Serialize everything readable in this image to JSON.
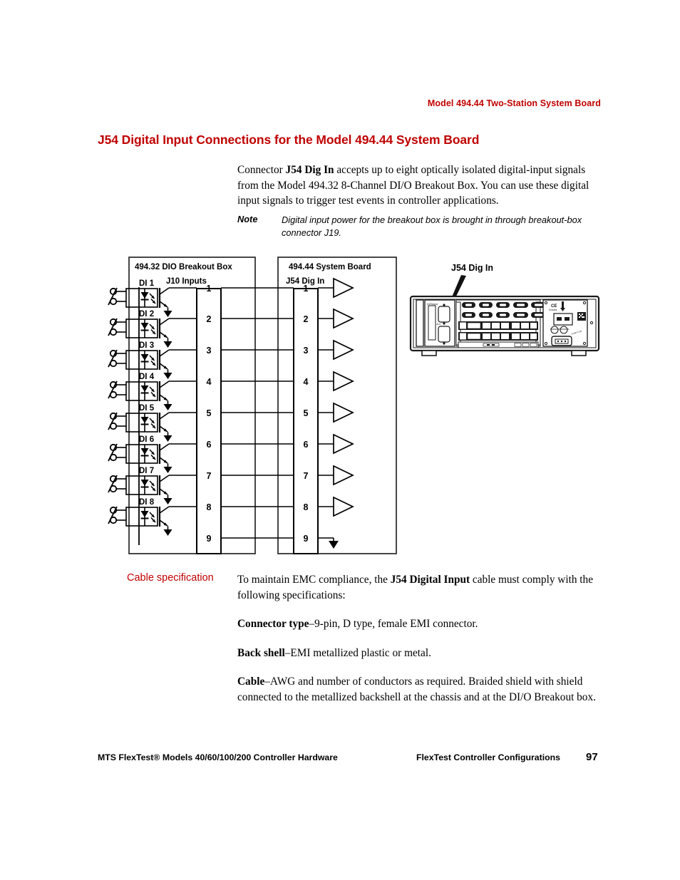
{
  "header": {
    "running_head": "Model 494.44 Two-Station System Board",
    "section_title": "J54 Digital Input Connections for the Model 494.44 System Board",
    "accent_color": "#c00000"
  },
  "intro": {
    "paragraph_pre": "Connector ",
    "paragraph_bold": "J54 Dig In",
    "paragraph_post": " accepts up to eight optically isolated digital-input signals from the Model 494.32 8-Channel DI/O Breakout Box. You can use these digital input signals to trigger test events in controller applications."
  },
  "note": {
    "label": "Note",
    "text": "Digital input power for the breakout box is brought in through breakout-box connector J19."
  },
  "figure": {
    "breakout_box_title": "494.32 DIO Breakout Box",
    "breakout_connector_title": "J10 Inputs",
    "system_board_title": "494.44  System Board",
    "system_connector_title": "J54 Dig In",
    "channel_labels": [
      "DI 1",
      "DI 2",
      "DI 3",
      "DI 4",
      "DI 5",
      "DI 6",
      "DI 7",
      "DI 8"
    ],
    "j10_pins": [
      "1",
      "2",
      "3",
      "4",
      "5",
      "6",
      "7",
      "8",
      "9"
    ],
    "j54_pins": [
      "1",
      "2",
      "3",
      "4",
      "5",
      "6",
      "7",
      "8",
      "9"
    ],
    "callout_label": "J54 Dig In"
  },
  "cable_spec": {
    "label": "Cable specification",
    "lead_pre": "To maintain EMC compliance, the ",
    "lead_bold": "J54 Digital Input",
    "lead_post": " cable must comply with the following specifications:",
    "items": [
      {
        "term": "Connector type",
        "desc": "–9-pin, D type, female EMI connector."
      },
      {
        "term": "Back shell",
        "desc": "–EMI metallized plastic or metal."
      },
      {
        "term": "Cable",
        "desc": "–AWG and number of conductors as required. Braided shield with shield connected to the metallized backshell at the chassis and at the DI/O Breakout box."
      }
    ]
  },
  "footer": {
    "left": "MTS FlexTest® Models 40/60/100/200 Controller Hardware",
    "middle": "FlexTest Controller Configurations",
    "page_number": "97"
  }
}
